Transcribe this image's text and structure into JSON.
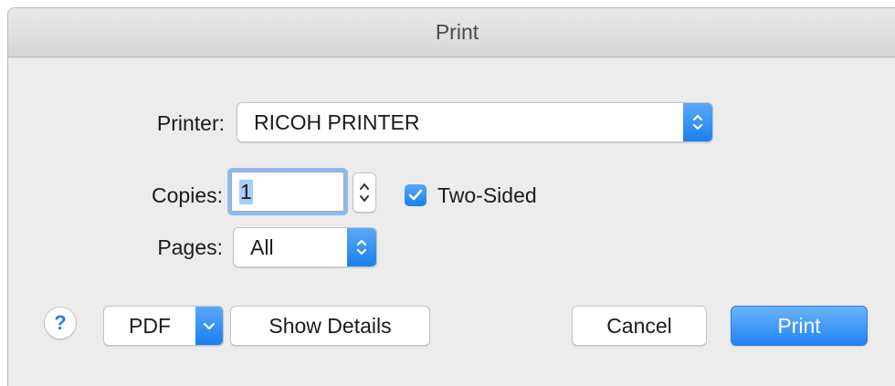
{
  "window": {
    "title": "Print"
  },
  "printer": {
    "label": "Printer:",
    "value": "RICOH PRINTER"
  },
  "copies": {
    "label": "Copies:",
    "value": "1"
  },
  "two_sided": {
    "label": "Two-Sided",
    "checked": true
  },
  "pages": {
    "label": "Pages:",
    "value": "All"
  },
  "footer": {
    "help_label": "?",
    "pdf_label": "PDF",
    "show_details_label": "Show Details",
    "cancel_label": "Cancel",
    "print_label": "Print"
  },
  "colors": {
    "accent": "#1f83f2",
    "window_bg": "#ececec"
  },
  "icons": {
    "popup": "up-down-chevron-icon",
    "checkbox": "checkmark-icon",
    "pdf": "chevron-down-icon",
    "stepper": "up-down-chevron-icon"
  }
}
